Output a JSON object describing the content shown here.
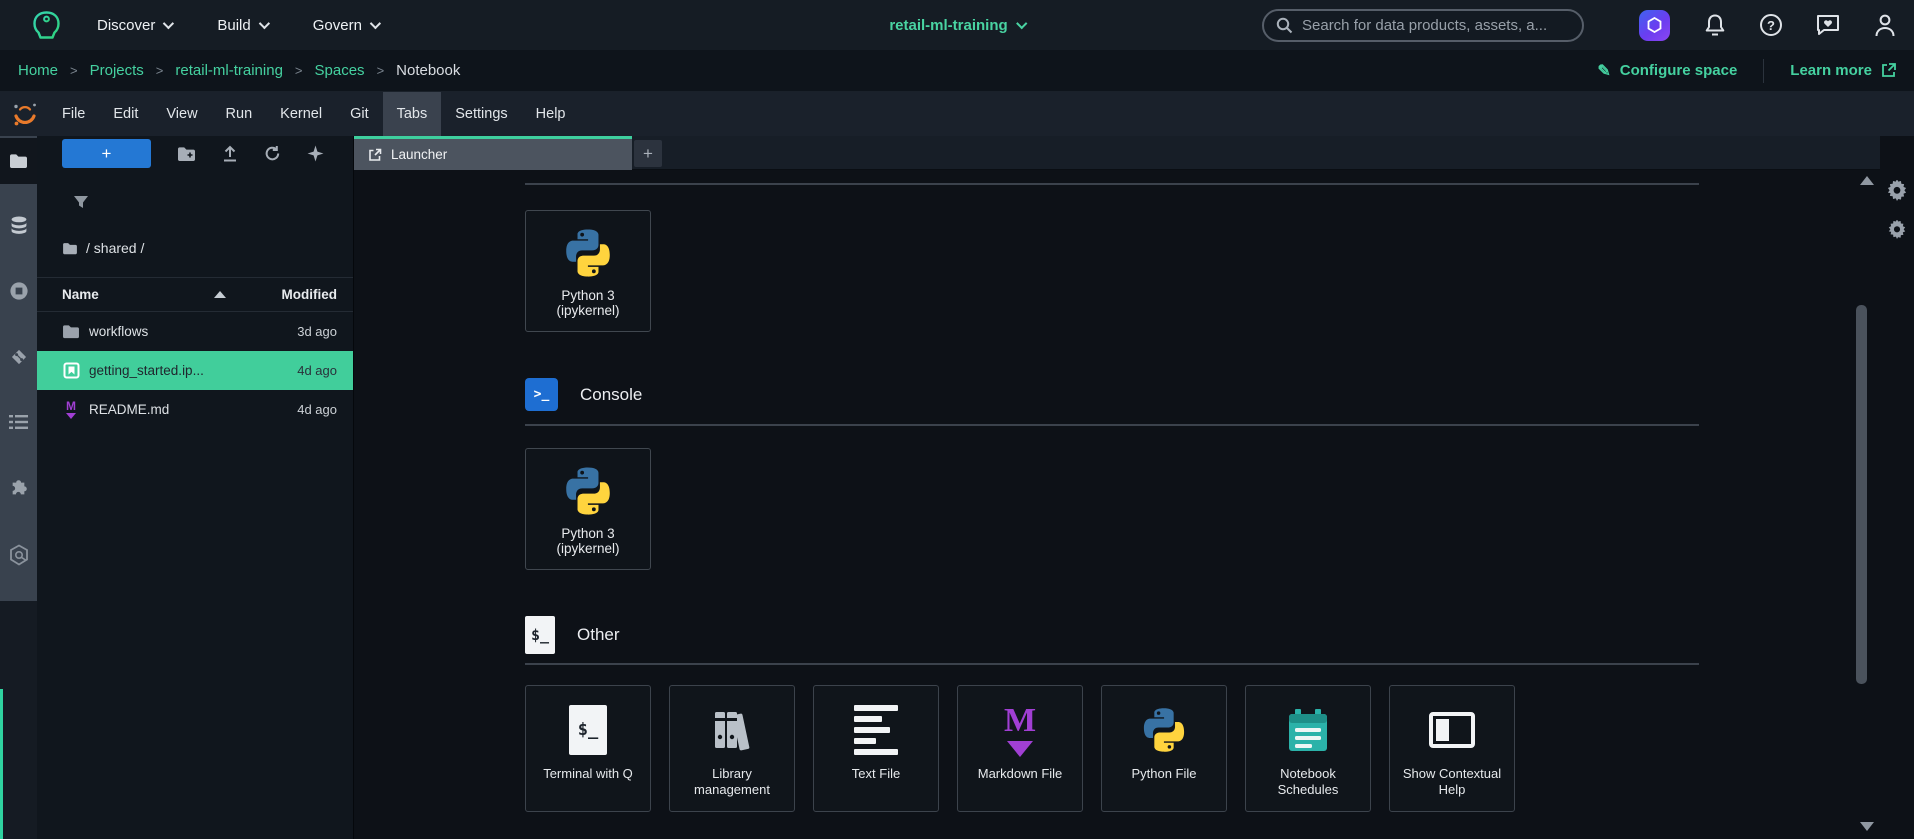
{
  "topbar": {
    "menus": [
      {
        "label": "Discover"
      },
      {
        "label": "Build"
      },
      {
        "label": "Govern"
      }
    ],
    "project_selector": "retail-ml-training",
    "search": {
      "placeholder": "Search for data products, assets, a..."
    },
    "action_icons": [
      "amazon-q",
      "notifications",
      "help",
      "feedback",
      "user-profile"
    ]
  },
  "breadcrumb_bar": {
    "items": [
      "Home",
      "Projects",
      "retail-ml-training",
      "Spaces",
      "Notebook"
    ],
    "configure_space": "Configure space",
    "learn_more": "Learn more"
  },
  "menubar": {
    "items": [
      "File",
      "Edit",
      "View",
      "Run",
      "Kernel",
      "Git",
      "Tabs",
      "Settings",
      "Help"
    ],
    "highlighted": "Tabs"
  },
  "tab_bar": {
    "active_tab": "Launcher",
    "new_tab_label": "+"
  },
  "file_browser": {
    "new_button_label": "+",
    "path": "/ shared /",
    "columns": {
      "name": "Name",
      "modified": "Modified"
    },
    "sort": {
      "column": "Name",
      "direction": "asc"
    },
    "rows": [
      {
        "name": "workflows",
        "modified": "3d ago",
        "type": "folder",
        "selected": false
      },
      {
        "name": "getting_started.ip...",
        "modified": "4d ago",
        "type": "notebook",
        "selected": true
      },
      {
        "name": "README.md",
        "modified": "4d ago",
        "type": "markdown",
        "selected": false
      }
    ]
  },
  "launcher": {
    "notebook_kernel": {
      "line1": "Python 3",
      "line2": "(ipykernel)"
    },
    "sections": {
      "console": {
        "title": "Console",
        "kernel": {
          "line1": "Python 3",
          "line2": "(ipykernel)"
        }
      },
      "other": {
        "title": "Other",
        "tiles": [
          {
            "label": "Terminal with Q"
          },
          {
            "label": "Library management"
          },
          {
            "label": "Text File"
          },
          {
            "label": "Markdown File"
          },
          {
            "label": "Python File"
          },
          {
            "label": "Notebook Schedules"
          },
          {
            "label": "Show Contextual Help"
          }
        ]
      }
    }
  },
  "sidebar_icons": [
    "file-browser",
    "data",
    "running-kernels",
    "git",
    "table-of-contents",
    "extensions",
    "amazon-q"
  ],
  "colors": {
    "accent_green": "#3ecf9e",
    "link_teal": "#45d1a0",
    "primary_blue": "#2478d4",
    "selected_row_green": "#41ce9b",
    "markdown_purple": "#a13fd4",
    "python_blue": "#3872a4",
    "python_yellow": "#ffd43e",
    "console_blue": "#1e6ed2",
    "schedule_teal": "#2bb2a9",
    "studio_orange": "#e97a2b"
  }
}
